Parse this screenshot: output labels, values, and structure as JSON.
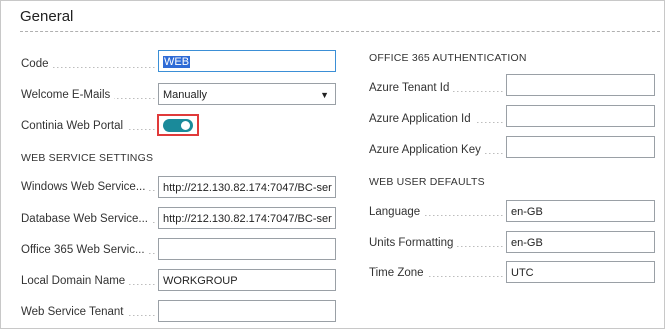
{
  "section": {
    "title": "General"
  },
  "left": {
    "code_label": "Code",
    "code_value": "WEB",
    "welcome_label": "Welcome E-Mails",
    "welcome_value": "Manually",
    "portal_label": "Continia Web Portal",
    "portal_enabled": true,
    "ws_heading": "WEB SERVICE SETTINGS",
    "windows_label": "Windows Web Service...",
    "windows_value": "http://212.130.82.174:7047/BC-ser",
    "database_label": "Database Web Service...",
    "database_value": "http://212.130.82.174:7047/BC-ser",
    "office_label": "Office 365 Web Servic...",
    "office_value": "",
    "domain_label": "Local Domain Name",
    "domain_value": "WORKGROUP",
    "tenant_label": "Web Service Tenant",
    "tenant_value": ""
  },
  "right": {
    "auth_heading": "OFFICE 365 AUTHENTICATION",
    "azure_tenant_label": "Azure Tenant Id",
    "azure_tenant_value": "",
    "azure_app_label": "Azure Application Id",
    "azure_app_value": "",
    "azure_key_label": "Azure Application Key",
    "azure_key_value": "",
    "defaults_heading": "WEB USER DEFAULTS",
    "language_label": "Language",
    "language_value": "en-GB",
    "units_label": "Units Formatting",
    "units_value": "en-GB",
    "timezone_label": "Time Zone",
    "timezone_value": "UTC"
  },
  "colors": {
    "accent": "#1a8a9a",
    "highlight": "#e03a3a",
    "selection": "#2f6bd6"
  },
  "icons": {
    "dropdown": "chevron-down-icon"
  }
}
